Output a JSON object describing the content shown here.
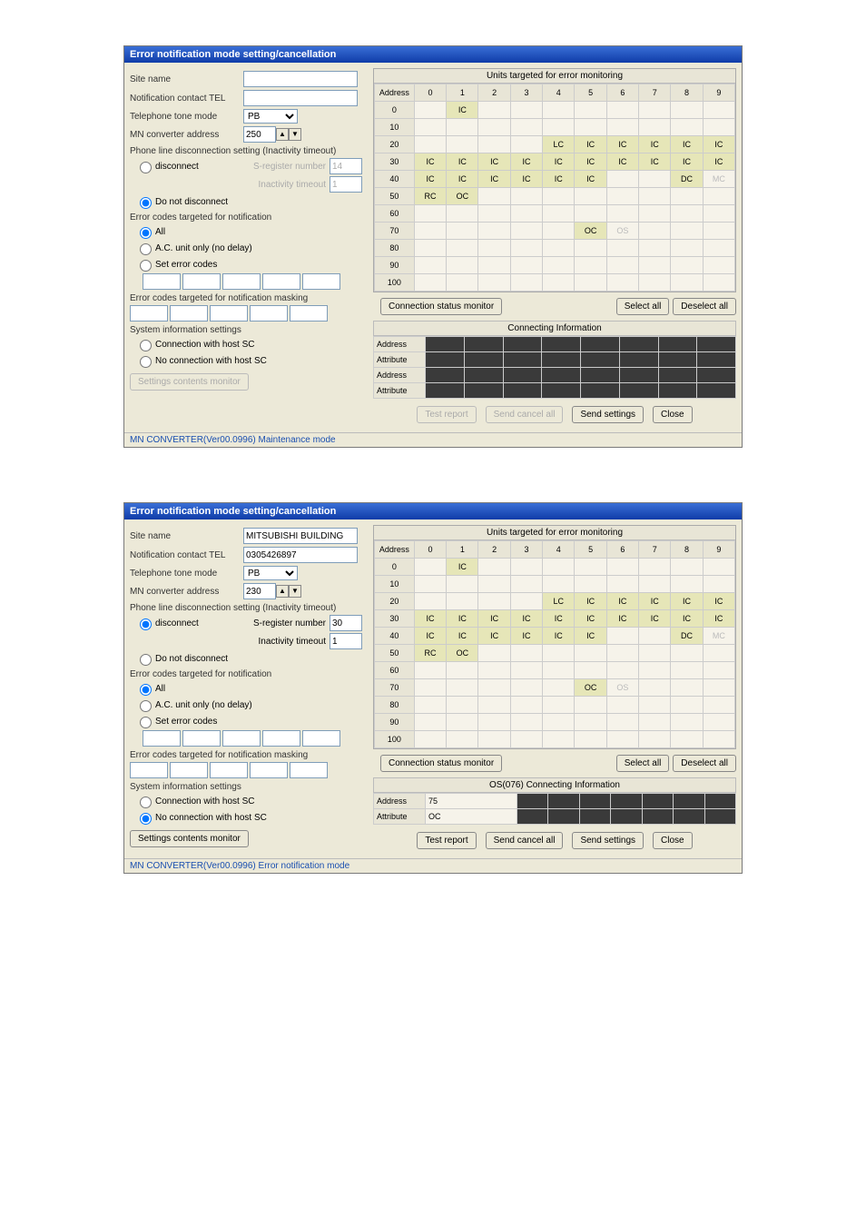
{
  "win1": {
    "title": "Error notification mode setting/cancellation",
    "labels": {
      "siteName": "Site name",
      "contactTel": "Notification contact TEL",
      "toneMode": "Telephone tone mode",
      "convAddr": "MN converter address",
      "phoneLine": "Phone line disconnection setting (Inactivity timeout)",
      "disconnect": "disconnect",
      "sreg": "S-register number",
      "inact": "Inactivity timeout",
      "doNot": "Do not disconnect",
      "errTarget": "Error codes targeted for notification",
      "all": "All",
      "acOnly": "A.C. unit only (no delay)",
      "setErr": "Set error codes",
      "masking": "Error codes targeted for notification masking",
      "sysInfo": "System information settings",
      "connWith": "Connection with host SC",
      "noConn": "No connection with host SC",
      "settingsMon": "Settings contents monitor"
    },
    "values": {
      "siteName": "",
      "contactTel": "",
      "toneSel": "PB",
      "addr": "250",
      "sreg": "14",
      "inact": "1"
    },
    "right": {
      "unitsTitle": "Units targeted for error monitoring",
      "addressHdr": "Address",
      "cols": [
        "0",
        "1",
        "2",
        "3",
        "4",
        "5",
        "6",
        "7",
        "8",
        "9"
      ],
      "rows": [
        "0",
        "10",
        "20",
        "30",
        "40",
        "50",
        "60",
        "70",
        "80",
        "90",
        "100"
      ],
      "cells": {
        "0": [
          "",
          "IC",
          "",
          "",
          "",
          "",
          "",
          "",
          "",
          ""
        ],
        "10": [
          "",
          "",
          "",
          "",
          "",
          "",
          "",
          "",
          "",
          ""
        ],
        "20": [
          "",
          "",
          "",
          "",
          "LC",
          "IC",
          "IC",
          "IC",
          "IC",
          "IC"
        ],
        "30": [
          "IC",
          "IC",
          "IC",
          "IC",
          "IC",
          "IC",
          "IC",
          "IC",
          "IC",
          "IC"
        ],
        "40": [
          "IC",
          "IC",
          "IC",
          "IC",
          "IC",
          "IC",
          "",
          "",
          "DC",
          "MC"
        ],
        "50": [
          "RC",
          "OC",
          "",
          "",
          "",
          "",
          "",
          "",
          "",
          ""
        ],
        "60": [
          "",
          "",
          "",
          "",
          "",
          "",
          "",
          "",
          "",
          ""
        ],
        "70": [
          "",
          "",
          "",
          "",
          "",
          "OC",
          "OS",
          "",
          "",
          ""
        ],
        "80": [
          "",
          "",
          "",
          "",
          "",
          "",
          "",
          "",
          "",
          ""
        ],
        "90": [
          "",
          "",
          "",
          "",
          "",
          "",
          "",
          "",
          "",
          ""
        ],
        "100": [
          "",
          "",
          "",
          "",
          "",
          "",
          "",
          "",
          "",
          ""
        ]
      },
      "connMon": "Connection status monitor",
      "selectAll": "Select all",
      "deselectAll": "Deselect all",
      "connInfoTitle": "Connecting Information",
      "rowHdrs": [
        "Address",
        "Attribute",
        "Address",
        "Attribute"
      ]
    },
    "bottom": {
      "testReport": "Test report",
      "sendCancel": "Send cancel all",
      "sendSettings": "Send settings",
      "close": "Close"
    },
    "status": "MN CONVERTER(Ver00.0996) Maintenance mode"
  },
  "win2": {
    "title": "Error notification mode setting/cancellation",
    "values": {
      "siteName": "MITSUBISHI BUILDING",
      "contactTel": "0305426897",
      "toneSel": "PB",
      "addr": "230",
      "sreg": "30",
      "inact": "1"
    },
    "right": {
      "cells": {
        "0": [
          "",
          "IC",
          "",
          "",
          "",
          "",
          "",
          "",
          "",
          ""
        ],
        "10": [
          "",
          "",
          "",
          "",
          "",
          "",
          "",
          "",
          "",
          ""
        ],
        "20": [
          "",
          "",
          "",
          "",
          "LC",
          "IC",
          "IC",
          "IC",
          "IC",
          "IC"
        ],
        "30": [
          "IC",
          "IC",
          "IC",
          "IC",
          "IC",
          "IC",
          "IC",
          "IC",
          "IC",
          "IC"
        ],
        "40": [
          "IC",
          "IC",
          "IC",
          "IC",
          "IC",
          "IC",
          "",
          "",
          "DC",
          "MC"
        ],
        "50": [
          "RC",
          "OC",
          "",
          "",
          "",
          "",
          "",
          "",
          "",
          ""
        ],
        "60": [
          "",
          "",
          "",
          "",
          "",
          "",
          "",
          "",
          "",
          ""
        ],
        "70": [
          "",
          "",
          "",
          "",
          "",
          "OC",
          "OS",
          "",
          "",
          ""
        ],
        "80": [
          "",
          "",
          "",
          "",
          "",
          "",
          "",
          "",
          "",
          ""
        ],
        "90": [
          "",
          "",
          "",
          "",
          "",
          "",
          "",
          "",
          "",
          ""
        ],
        "100": [
          "",
          "",
          "",
          "",
          "",
          "",
          "",
          "",
          "",
          ""
        ]
      },
      "connInfoTitle": "OS(076) Connecting Information",
      "infoAddr": "75",
      "infoAttr": "OC"
    },
    "status": "MN CONVERTER(Ver00.0996) Error notification mode"
  }
}
